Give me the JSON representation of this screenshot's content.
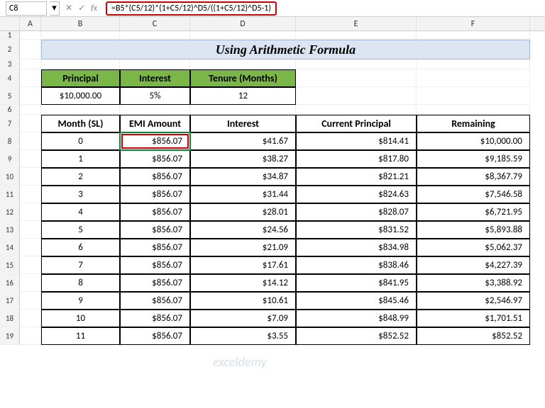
{
  "namebox": "C8",
  "formula": "=B5*(C5/12)*(1+C5/12)^D5/((1+C5/12)^D5-1)",
  "columns": [
    "",
    "A",
    "B",
    "C",
    "D",
    "E",
    "F"
  ],
  "title": "Using Arithmetic Formula",
  "params": {
    "headers": [
      "Principal",
      "Interest",
      "Tenure (Months)"
    ],
    "values": [
      "$10,000.00",
      "5%",
      "12"
    ]
  },
  "table": {
    "headers": [
      "Month (SL)",
      "EMI Amount",
      "Interest",
      "Current Principal",
      "Remaining"
    ],
    "rows": [
      [
        "0",
        "$856.07",
        "$41.67",
        "$814.41",
        "$10,000.00"
      ],
      [
        "1",
        "$856.07",
        "$38.27",
        "$817.80",
        "$9,185.59"
      ],
      [
        "2",
        "$856.07",
        "$34.87",
        "$821.21",
        "$8,367.79"
      ],
      [
        "3",
        "$856.07",
        "$31.44",
        "$824.63",
        "$7,546.58"
      ],
      [
        "4",
        "$856.07",
        "$28.01",
        "$828.07",
        "$6,721.95"
      ],
      [
        "5",
        "$856.07",
        "$24.56",
        "$831.52",
        "$5,893.88"
      ],
      [
        "6",
        "$856.07",
        "$21.09",
        "$834.98",
        "$5,062.37"
      ],
      [
        "7",
        "$856.07",
        "$17.61",
        "$838.46",
        "$4,227.39"
      ],
      [
        "8",
        "$856.07",
        "$14.12",
        "$841.95",
        "$3,388.92"
      ],
      [
        "9",
        "$856.07",
        "$10.61",
        "$845.46",
        "$2,546.97"
      ],
      [
        "10",
        "$856.07",
        "$7.09",
        "$848.99",
        "$1,701.51"
      ],
      [
        "11",
        "$856.07",
        "$3.55",
        "$852.52",
        "$852.52"
      ]
    ]
  },
  "watermark": "exceldemy",
  "chart_data": {
    "type": "table",
    "title": "Using Arithmetic Formula",
    "series": [
      {
        "name": "Month (SL)",
        "values": [
          0,
          1,
          2,
          3,
          4,
          5,
          6,
          7,
          8,
          9,
          10,
          11
        ]
      },
      {
        "name": "EMI Amount",
        "values": [
          856.07,
          856.07,
          856.07,
          856.07,
          856.07,
          856.07,
          856.07,
          856.07,
          856.07,
          856.07,
          856.07,
          856.07
        ]
      },
      {
        "name": "Interest",
        "values": [
          41.67,
          38.27,
          34.87,
          31.44,
          28.01,
          24.56,
          21.09,
          17.61,
          14.12,
          10.61,
          7.09,
          3.55
        ]
      },
      {
        "name": "Current Principal",
        "values": [
          814.41,
          817.8,
          821.21,
          824.63,
          828.07,
          831.52,
          834.98,
          838.46,
          841.95,
          845.46,
          848.99,
          852.52
        ]
      },
      {
        "name": "Remaining",
        "values": [
          10000.0,
          9185.59,
          8367.79,
          7546.58,
          6721.95,
          5893.88,
          5062.37,
          4227.39,
          3388.92,
          2546.97,
          1701.51,
          852.52
        ]
      }
    ]
  }
}
